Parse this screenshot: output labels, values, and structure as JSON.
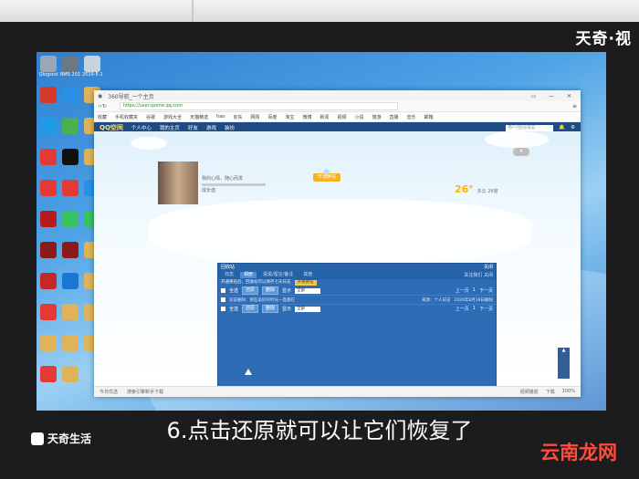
{
  "corner_brand": "天奇·视",
  "desktop_icons": [
    {
      "label": "Qlogsnd",
      "color": "#9aa7b4"
    },
    {
      "label": "BMS 2019...",
      "color": "#6d7785"
    },
    {
      "label": "2019-5-13",
      "color": "#c8d3de"
    },
    {
      "label": "",
      "color": "#d23a2c"
    },
    {
      "label": "",
      "color": "#2b8fe6"
    },
    {
      "label": "",
      "color": "#e0b35a"
    },
    {
      "label": "",
      "color": "#1d9be8"
    },
    {
      "label": "",
      "color": "#4caf50"
    },
    {
      "label": "",
      "color": "#e0b35a"
    },
    {
      "label": "",
      "color": "#e53935"
    },
    {
      "label": "",
      "color": "#111111"
    },
    {
      "label": "",
      "color": "#e0b35a"
    },
    {
      "label": "",
      "color": "#e53935"
    },
    {
      "label": "",
      "color": "#e53935"
    },
    {
      "label": "",
      "color": "#2b8fe6"
    },
    {
      "label": "",
      "color": "#b71c1c"
    },
    {
      "label": "",
      "color": "#3ac162"
    },
    {
      "label": "",
      "color": "#3ac162"
    },
    {
      "label": "",
      "color": "#8b1a1a"
    },
    {
      "label": "",
      "color": "#8b1a1a"
    },
    {
      "label": "",
      "color": "#e0b35a"
    },
    {
      "label": "",
      "color": "#c62828"
    },
    {
      "label": "",
      "color": "#1976d2"
    },
    {
      "label": "",
      "color": "#e0b35a"
    },
    {
      "label": "",
      "color": "#e53935"
    },
    {
      "label": "",
      "color": "#e0b35a"
    },
    {
      "label": "",
      "color": "#e0b35a"
    },
    {
      "label": "",
      "color": "#e0b35a"
    },
    {
      "label": "",
      "color": "#e0b35a"
    },
    {
      "label": "",
      "color": "#e0b35a"
    },
    {
      "label": "",
      "color": "#e53935"
    },
    {
      "label": "",
      "color": "#e0b35a"
    }
  ],
  "browser": {
    "title": "360导航_一个主页",
    "window_controls": "▭ — ✕",
    "address": "https://user.qzone.qq.com",
    "bookmarks": [
      "收藏",
      "手机收藏夹",
      "谷歌",
      "游戏大全",
      "天猫精选",
      "hao",
      "京东",
      "网购",
      "百度",
      "淘宝",
      "微博",
      "新闻",
      "视频",
      "小说",
      "旅游",
      "直播",
      "音乐",
      "邮箱"
    ],
    "statusbar_left": [
      "今日优选",
      "搜索引擎新手下载"
    ],
    "statusbar_right": [
      "视频播放",
      "下载",
      "100%"
    ]
  },
  "qzone": {
    "logo": "QQ空间",
    "nav": [
      "个人中心",
      "我的主页",
      "好友",
      "游戏",
      "装扮"
    ],
    "search_placeholder": "用户/空间/日志",
    "profile_line": "我的心情，随心而发",
    "level_label": "成长值",
    "vip_button": "开通黄钻",
    "temperature": "26°",
    "weather_note": "多云 26度",
    "msg_count": "4"
  },
  "recycle_bin": {
    "title": "回收站",
    "close": "关闭",
    "tabs": [
      "日志",
      "相册",
      "说说/留言/备注",
      "其他"
    ],
    "tabs_right": "关注我们 关闭",
    "notice": "开通黄钻后，回收站可以保存七天日志",
    "notice_button": "开通黄钻",
    "select_all": "全选",
    "restore_button": "还原",
    "delete_button": "删除",
    "show_label": "显示",
    "show_value": "全部",
    "prev": "上一页",
    "page": "1",
    "next": "下一页",
    "rows": [
      {
        "text": "说说删除：那些美好的时光一直都在",
        "from": "来源：个人日志",
        "time": "2020年8月18日删除"
      }
    ]
  },
  "subtitle": "6.点击还原就可以让它们恢复了",
  "logo_bottom_left": "天奇生活",
  "watermark": "云南龙网"
}
